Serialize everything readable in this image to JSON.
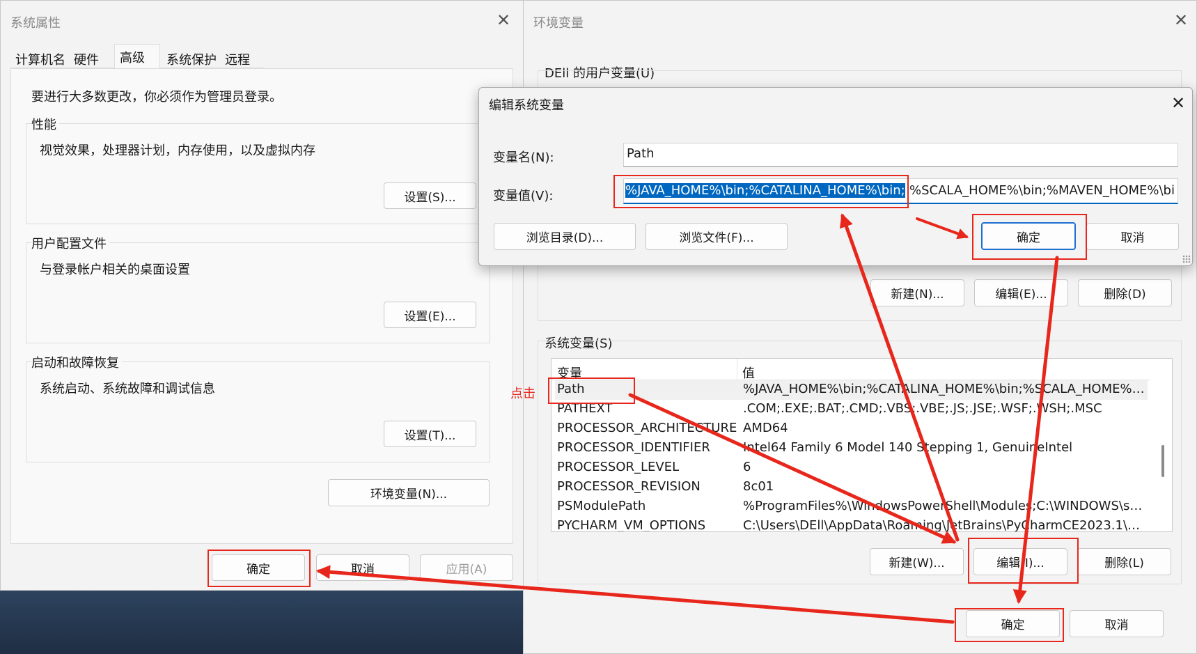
{
  "sysprops": {
    "title": "系统属性",
    "tabs": [
      "计算机名",
      "硬件",
      "高级",
      "系统保护",
      "远程"
    ],
    "admin_note": "要进行大多数更改，你必须作为管理员登录。",
    "performance": {
      "label": "性能",
      "desc": "视觉效果，处理器计划，内存使用，以及虚拟内存",
      "button": "设置(S)..."
    },
    "profile": {
      "label": "用户配置文件",
      "desc": "与登录帐户相关的桌面设置",
      "button": "设置(E)..."
    },
    "startup": {
      "label": "启动和故障恢复",
      "desc": "系统启动、系统故障和调试信息",
      "button": "设置(T)..."
    },
    "env_button": "环境变量(N)...",
    "ok": "确定",
    "cancel": "取消",
    "apply": "应用(A)"
  },
  "envvars": {
    "title": "环境变量",
    "user_label": "DEll 的用户变量(U)",
    "user_new": "新建(N)...",
    "user_edit": "编辑(E)...",
    "user_delete": "删除(D)",
    "system_label": "系统变量(S)",
    "col_var": "变量",
    "col_val": "值",
    "rows": [
      {
        "name": "Path",
        "value": "%JAVA_HOME%\\bin;%CATALINA_HOME%\\bin;%SCALA_HOME%\\..."
      },
      {
        "name": "PATHEXT",
        "value": ".COM;.EXE;.BAT;.CMD;.VBS;.VBE;.JS;.JSE;.WSF;.WSH;.MSC"
      },
      {
        "name": "PROCESSOR_ARCHITECTURE",
        "value": "AMD64"
      },
      {
        "name": "PROCESSOR_IDENTIFIER",
        "value": "Intel64 Family 6 Model 140 Stepping 1, GenuineIntel"
      },
      {
        "name": "PROCESSOR_LEVEL",
        "value": "6"
      },
      {
        "name": "PROCESSOR_REVISION",
        "value": "8c01"
      },
      {
        "name": "PSModulePath",
        "value": "%ProgramFiles%\\WindowsPowerShell\\Modules;C:\\WINDOWS\\syst..."
      },
      {
        "name": "PYCHARM_VM_OPTIONS",
        "value": "C:\\Users\\DEll\\AppData\\Roaming\\JetBrains\\PyCharmCE2023.1\\pyc..."
      }
    ],
    "sys_new": "新建(W)...",
    "sys_edit": "编辑(I)...",
    "sys_delete": "删除(L)",
    "ok": "确定",
    "cancel": "取消"
  },
  "editdlg": {
    "title": "编辑系统变量",
    "name_label": "变量名(N):",
    "name_value": "Path",
    "value_label": "变量值(V):",
    "value_selected": "%JAVA_HOME%\\bin;%CATALINA_HOME%\\bin;",
    "value_rest": "%SCALA_HOME%\\bin;%MAVEN_HOME%\\bi",
    "browse_dir": "浏览目录(D)...",
    "browse_file": "浏览文件(F)...",
    "ok": "确定",
    "cancel": "取消"
  },
  "annotation": {
    "click_label": "点击",
    "color": "#e8271c"
  },
  "colors": {
    "selection": "#0067c0",
    "primary_border": "#1f6fd1"
  }
}
